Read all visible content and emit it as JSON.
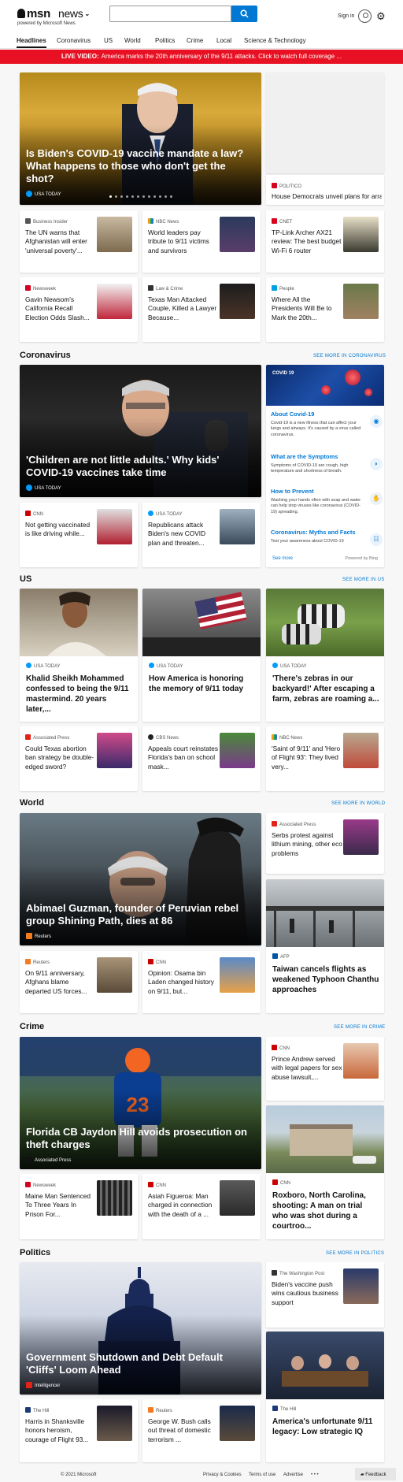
{
  "header": {
    "logo_msn": "msn",
    "logo_news": "news",
    "powered_by": "powered by Microsoft News",
    "search_placeholder": "",
    "sign_in": "Sign in"
  },
  "nav": {
    "tabs": [
      "Headlines",
      "Coronavirus",
      "US",
      "World",
      "Politics",
      "Crime",
      "Local",
      "Science & Technology"
    ]
  },
  "live_banner": {
    "tag": "LIVE VIDEO:",
    "text": "America marks the 20th anniversary of the 9/11 attacks. Click to watch full coverage ..."
  },
  "headlines": {
    "hero": {
      "title": "Is Biden's COVID-19 vaccine mandate a law? What happens to those who don't get the shot?",
      "source": "USA TODAY"
    },
    "side_card": {
      "source": "POLITICO",
      "title": "House Democrats unveil plans for array ..."
    },
    "cards": [
      {
        "source": "Business Insider",
        "title": "The UN warns that Afghanistan will enter 'universal poverty'..."
      },
      {
        "source": "NBC News",
        "title": "World leaders pay tribute to 9/11 victims and survivors"
      },
      {
        "source": "CNET",
        "title": "TP-Link Archer AX21 review: The best budget Wi-Fi 6 router"
      },
      {
        "source": "Newsweek",
        "title": "Gavin Newsom's California Recall Election Odds Slash..."
      },
      {
        "source": "Law & Crime",
        "title": "Texas Man Attacked Couple, Killed a Lawyer Because..."
      },
      {
        "source": "People",
        "title": "Where All the Presidents Will Be to Mark the 20th..."
      }
    ]
  },
  "coronavirus": {
    "section_title": "Coronavirus",
    "see_more": "SEE MORE IN CORONAVIRUS",
    "hero": {
      "title": "'Children are not little adults.' Why kids' COVID-19 vaccines take time",
      "source": "USA TODAY"
    },
    "cards": [
      {
        "source": "CNN",
        "title": "Not getting vaccinated is like driving while..."
      },
      {
        "source": "USA TODAY",
        "title": "Republicans attack Biden's new COVID plan and threaten..."
      }
    ],
    "panel": {
      "badge": "COVID 19",
      "items": [
        {
          "title": "About Covid-19",
          "desc": "Covid-19 is a new illness that can affect your lungs and airways. It's caused by a virus called coronavirus."
        },
        {
          "title": "What are the Symptoms",
          "desc": "Symptoms of COVID-19 are cough, high temperature and shortness of breath."
        },
        {
          "title": "How to Prevent",
          "desc": "Washing your hands often with soap and water can help stop viruses like coronavirus (COVID-19) spreading."
        },
        {
          "title": "Coronavirus: Myths and Facts",
          "desc": "Test your awareness about COVID-19"
        }
      ],
      "see_more": "See more",
      "powered": "Powered by Bing"
    }
  },
  "us": {
    "section_title": "US",
    "see_more": "SEE MORE IN US",
    "big_cards": [
      {
        "source": "USA TODAY",
        "title": "Khalid Sheikh Mohammed confessed to being the 9/11 mastermind. 20 years later,..."
      },
      {
        "source": "USA TODAY",
        "title": "How America is honoring the memory of 9/11 today"
      },
      {
        "source": "USA TODAY",
        "title": "'There's zebras in our backyard!' After escaping a farm, zebras are roaming a..."
      }
    ],
    "cards": [
      {
        "source": "Associated Press",
        "title": "Could Texas abortion ban strategy be double-edged sword?"
      },
      {
        "source": "CBS News",
        "title": "Appeals court reinstates Florida's ban on school mask..."
      },
      {
        "source": "NBC News",
        "title": "'Saint of 9/11' and 'Hero of Flight 93': They lived very..."
      }
    ]
  },
  "world": {
    "section_title": "World",
    "see_more": "SEE MORE IN WORLD",
    "hero": {
      "title": "Abimael Guzman, founder of Peruvian rebel group Shining Path, dies at 86",
      "source": "Reuters"
    },
    "side_card": {
      "source": "Associated Press",
      "title": "Serbs protest against lithium mining, other eco problems"
    },
    "side_big": {
      "source": "AFP",
      "title": "Taiwan cancels flights as weakened Typhoon Chanthu approaches"
    },
    "cards": [
      {
        "source": "Reuters",
        "title": "On 9/11 anniversary, Afghans blame departed US forces..."
      },
      {
        "source": "CNN",
        "title": "Opinion: Osama bin Laden changed history on 9/11, but..."
      }
    ]
  },
  "crime": {
    "section_title": "Crime",
    "see_more": "SEE MORE IN CRIME",
    "hero": {
      "title": "Florida CB Jaydon Hill avoids prosecution on theft charges",
      "source": "Associated Press"
    },
    "side_card": {
      "source": "CNN",
      "title": "Prince Andrew served with legal papers for sex abuse lawsuit,..."
    },
    "side_big": {
      "source": "CNN",
      "title": "Roxboro, North Carolina, shooting: A man on trial who was shot during a courtroo..."
    },
    "cards": [
      {
        "source": "Newsweek",
        "title": "Maine Man Sentenced To Three Years In Prison For..."
      },
      {
        "source": "CNN",
        "title": "Asiah Figueroa: Man charged in connection with the death of a ..."
      }
    ]
  },
  "politics": {
    "section_title": "Politics",
    "see_more": "SEE MORE IN POLITICS",
    "hero": {
      "title": "Government Shutdown and Debt Default 'Cliffs' Loom Ahead",
      "source": "Intelligencer"
    },
    "side_card": {
      "source": "The Washington Post",
      "title": "Biden's vaccine push wins cautious business support"
    },
    "side_big": {
      "source": "The Hill",
      "title": "America's unfortunate 9/11 legacy: Low strategic IQ"
    },
    "cards": [
      {
        "source": "The Hill",
        "title": "Harris in Shanksville honors heroism, courage of Flight 93..."
      },
      {
        "source": "Reuters",
        "title": "George W. Bush calls out threat of domestic terrorism ..."
      }
    ]
  },
  "footer": {
    "copyright": "© 2021 Microsoft",
    "links": [
      "Privacy & Cookies",
      "Terms of use",
      "Advertise",
      "• • •"
    ],
    "feedback": "Feedback"
  },
  "colors": {
    "accent": "#0078d4",
    "banner": "#e81123"
  }
}
